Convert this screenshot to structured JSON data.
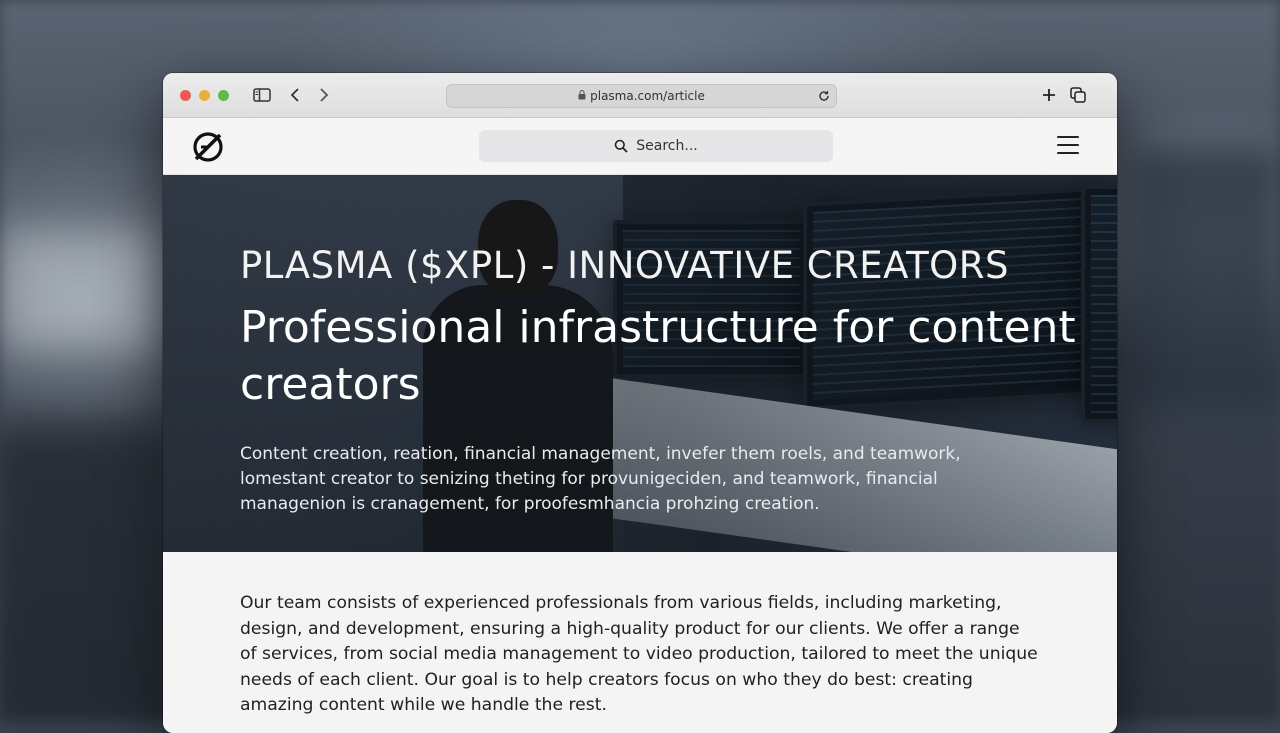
{
  "browser": {
    "url": "plasma.com/article",
    "icons": {
      "sidebar": "sidebar-icon",
      "back": "chevron-left-icon",
      "forward": "chevron-right-icon",
      "lock": "lock-icon",
      "reload": "reload-icon",
      "new_tab": "plus-icon",
      "tabs": "tabs-icon"
    }
  },
  "site": {
    "logo": "plasma-logo",
    "search_placeholder": "Search...",
    "menu_icon": "hamburger-menu-icon"
  },
  "hero": {
    "eyebrow": "PLASMA ($XPL) - INNOVATIVE CREATORS",
    "headline": "Professional infrastructure for content creators",
    "subcopy": "Content creation, reation, financial management, invefer them roels, and teamwork, lomestant creator to senizing theting for provunigeciden, and teamwork, financial managenion is cranagement, for proofesmhancia prohzing creation."
  },
  "article": {
    "body": "Our team consists of experienced professionals from various fields, including marketing, design, and development, ensuring a high-quality product for our clients. We offer a range of services, from social media management to video production, tailored to meet the unique needs of each client. Our goal is to help creators focus on who they do best: creating amazing content while we handle the rest."
  },
  "colors": {
    "traffic_red": "#ec5b53",
    "traffic_yellow": "#e6b13b",
    "traffic_green": "#5bbd48"
  }
}
